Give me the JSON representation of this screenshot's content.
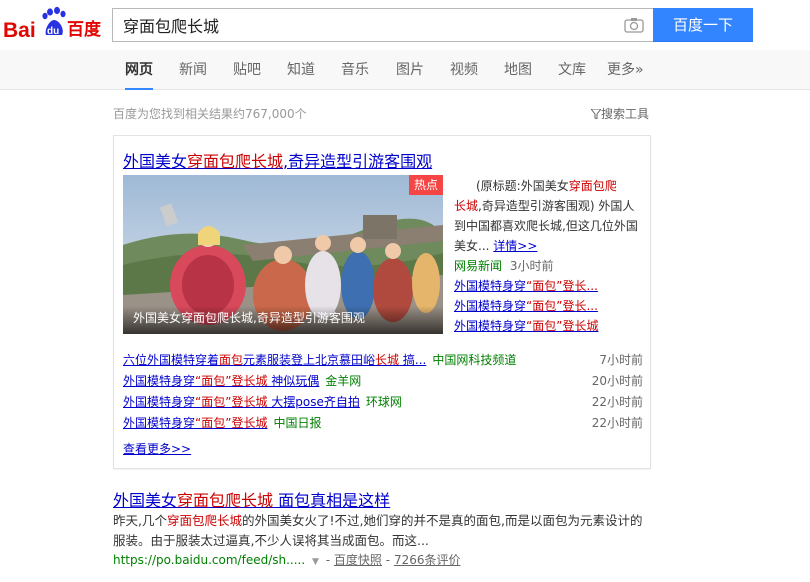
{
  "header": {
    "logo_left": "Bai",
    "logo_du": "du",
    "logo_cn": "百度",
    "search_value": "穿面包爬长城",
    "search_button": "百度一下"
  },
  "tabs": [
    {
      "label": "网页",
      "active": true
    },
    {
      "label": "新闻"
    },
    {
      "label": "贴吧"
    },
    {
      "label": "知道"
    },
    {
      "label": "音乐"
    },
    {
      "label": "图片"
    },
    {
      "label": "视频"
    },
    {
      "label": "地图"
    },
    {
      "label": "文库"
    },
    {
      "label": "更多»"
    }
  ],
  "result_count": "百度为您找到相关结果约767,000个",
  "tools_label": "搜索工具",
  "news_card": {
    "title_parts": [
      "外国美女",
      "穿面包爬长城",
      ",奇异造型引游客围观"
    ],
    "hot_badge": "热点",
    "image_caption": "外国美女穿面包爬长城,奇异造型引游客围观",
    "abstract_parts": [
      "(原标题:外国美女",
      "穿面包爬",
      "长城",
      ",奇异造型引游客围观) 外国人到中国都喜欢爬长城,但这几位外国美女...",
      "详情>>"
    ],
    "source": "网易新闻",
    "source_time": "3小时前",
    "side_links": [
      [
        "外国模特身穿",
        "“面包”",
        "登长..."
      ],
      [
        "外国模特身穿",
        "“面包”",
        "登长..."
      ],
      [
        "外国模特身穿",
        "“面包”",
        "登长城"
      ]
    ],
    "rows": [
      {
        "parts": [
          "六位外国模特穿着",
          "面包",
          "元素服装登上北京慕田峪",
          "长城",
          " 搞..."
        ],
        "source": "中国网科技频道",
        "time": "7小时前"
      },
      {
        "parts": [
          "外国模特身穿",
          "“面包”",
          "登长城",
          " 神似玩偶"
        ],
        "source": "金羊网",
        "time": "20小时前"
      },
      {
        "parts": [
          "外国模特身穿",
          "“面包”",
          "登长城",
          " 大摆pose齐自拍"
        ],
        "source": "环球网",
        "time": "22小时前"
      },
      {
        "parts": [
          "外国模特身穿",
          "“面包”",
          "登长城",
          ""
        ],
        "source": "中国日报",
        "time": "22小时前"
      }
    ],
    "more": "查看更多>>"
  },
  "result2": {
    "title_parts": [
      "外国美女",
      "穿面包爬长城",
      " 面包真相是这样"
    ],
    "abstract_parts": [
      "昨天,几个",
      "穿面包爬长城",
      "的外国美女火了!不过,她们穿的并不是真的面包,而是以面包为元素设计的服装。由于服装太过逼真,不少人误将其当成面包。而这..."
    ],
    "url": "https://po.baidu.com/feed/sh.....",
    "snapshot": "百度快照",
    "reviews": "7266条评价"
  },
  "colors": {
    "accent": "#3385ff",
    "link": "#0000cc",
    "highlight": "#cc0000",
    "source_green": "#008000",
    "hot_red": "#f54545"
  }
}
